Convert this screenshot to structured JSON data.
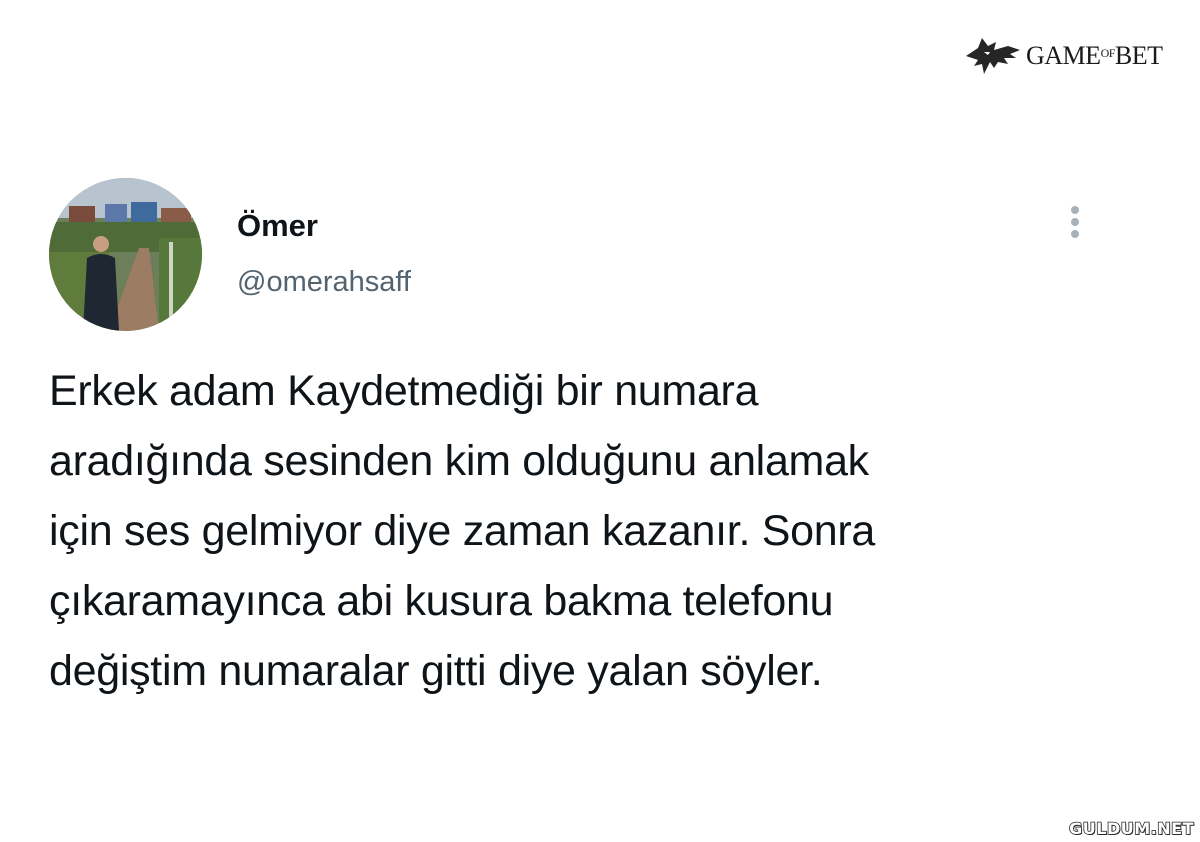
{
  "brand": {
    "icon": "wolf-head-icon",
    "text": "GAME",
    "text_small": "OF",
    "text_end": "BET"
  },
  "tweet": {
    "author": {
      "display_name": "Ömer",
      "handle": "@omerahsaff",
      "avatar": "profile-photo"
    },
    "more_icon": "more-vertical-icon",
    "text_lines": [
      "Erkek adam Kaydetmediği bir numara",
      "aradığında sesinden kim olduğunu anlamak",
      "için ses gelmiyor diye zaman kazanır. Sonra",
      "çıkaramayınca abi kusura bakma telefonu",
      "değiştim numaralar gitti diye yalan söyler."
    ]
  },
  "watermark": {
    "site": "GULDUM.NET"
  }
}
